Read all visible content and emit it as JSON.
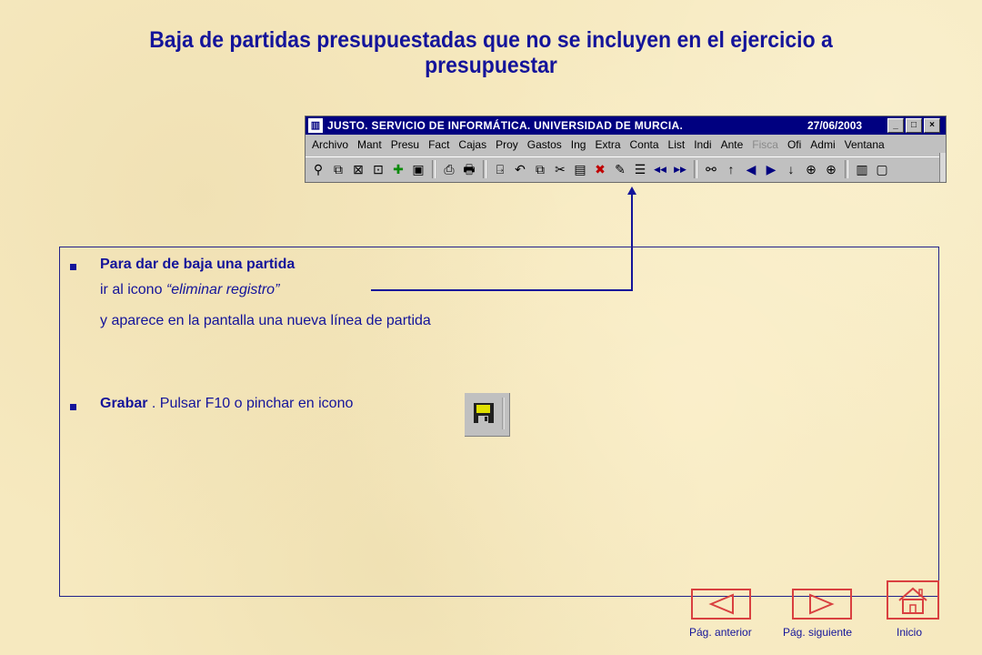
{
  "slide": {
    "title": "Baja de partidas presupuestadas que no se incluyen en el ejercicio a presupuestar"
  },
  "app_window": {
    "title": "JUSTO. SERVICIO DE INFORMÁTICA. UNIVERSIDAD DE MURCIA.",
    "date": "27/06/2003",
    "window_buttons": [
      "_",
      "□",
      "×"
    ],
    "menu": [
      {
        "label": "Archivo",
        "enabled": true
      },
      {
        "label": "Mant",
        "enabled": true
      },
      {
        "label": "Presu",
        "enabled": true
      },
      {
        "label": "Fact",
        "enabled": true
      },
      {
        "label": "Cajas",
        "enabled": true
      },
      {
        "label": "Proy",
        "enabled": true
      },
      {
        "label": "Gastos",
        "enabled": true
      },
      {
        "label": "Ing",
        "enabled": true
      },
      {
        "label": "Extra",
        "enabled": true
      },
      {
        "label": "Conta",
        "enabled": true
      },
      {
        "label": "List",
        "enabled": true
      },
      {
        "label": "Indi",
        "enabled": true
      },
      {
        "label": "Ante",
        "enabled": true
      },
      {
        "label": "Fisca",
        "enabled": false
      },
      {
        "label": "Ofi",
        "enabled": true
      },
      {
        "label": "Admi",
        "enabled": true
      },
      {
        "label": "Ventana",
        "enabled": true
      }
    ],
    "toolbar_icons": [
      "query-icon",
      "multi-query-icon",
      "clear-query-icon",
      "execute-query-icon",
      "add-record-icon",
      "save-icon",
      "separator",
      "print-preview-icon",
      "print-icon",
      "separator",
      "exit-icon",
      "undo-icon",
      "copy-icon",
      "cut-icon",
      "paste-icon",
      "delete-record-icon",
      "edit-icon",
      "edit-list-icon",
      "first-record-icon",
      "last-record-icon",
      "separator",
      "search-icon",
      "up-icon",
      "previous-icon",
      "next-icon",
      "down-icon",
      "zoom-in-icon",
      "zoom-icon",
      "separator",
      "clipboard-icon",
      "window-icon"
    ]
  },
  "content": {
    "item1_bold": "Para dar de baja una partida",
    "item1_line2_prefix": "ir al icono ",
    "item1_line2_italic": "“eliminar registro”",
    "item1_line3": "y aparece en la pantalla una nueva línea de partida",
    "item2_bold": "Grabar",
    "item2_rest": " . Pulsar F10 o pinchar en icono"
  },
  "nav": {
    "prev_label": "Pág. anterior",
    "next_label": "Pág. siguiente",
    "home_label": "Inicio"
  },
  "colors": {
    "background": "#f6e9bf",
    "text": "#14149a",
    "nav_border": "#d94040",
    "titlebar": "#000080"
  }
}
